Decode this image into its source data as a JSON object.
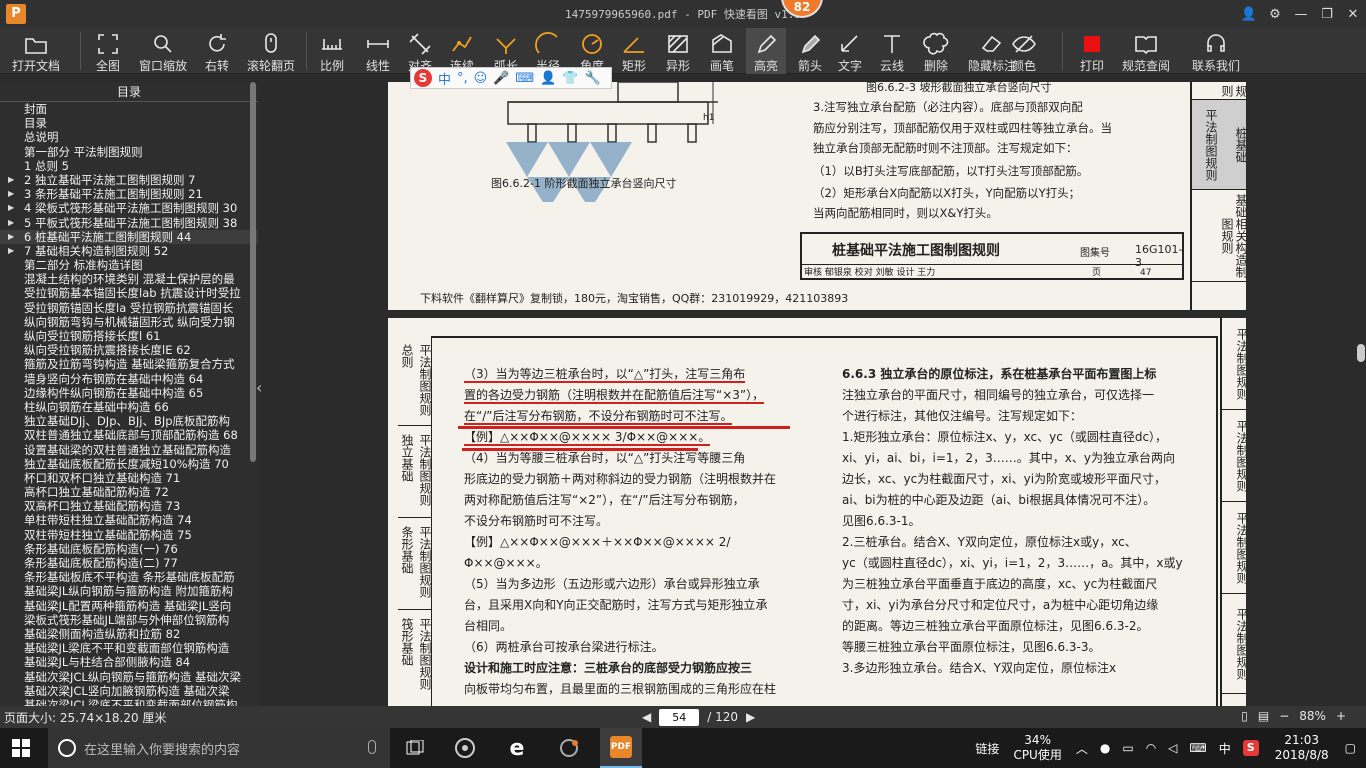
{
  "titlebar": {
    "title": "1475979965960.pdf - PDF 快速看图 v1.9",
    "logo": "P",
    "badge": "82"
  },
  "toolbar": {
    "items": [
      "打开文档",
      "全图",
      "窗口缩放",
      "右转",
      "滚轮翻页",
      "比例",
      "线性",
      "对齐",
      "连续",
      "弧长",
      "半径",
      "角度",
      "矩形",
      "异形",
      "画笔",
      "高亮",
      "箭头",
      "文字",
      "云线",
      "删除",
      "隐藏标注",
      "颜色",
      "打印",
      "规范查阅",
      "联系我们"
    ],
    "active": "高亮",
    "color_swatch": "#e81010"
  },
  "sidebar": {
    "header": "目录",
    "items": [
      {
        "label": "封面",
        "arrow": false
      },
      {
        "label": "目录",
        "arrow": false
      },
      {
        "label": "总说明",
        "arrow": false
      },
      {
        "label": "第一部分 平法制图规则",
        "arrow": false
      },
      {
        "label": "1 总则 5",
        "arrow": false
      },
      {
        "label": "2 独立基础平法施工图制图规则 7",
        "arrow": true
      },
      {
        "label": "3 条形基础平法施工图制图规则 21",
        "arrow": true
      },
      {
        "label": "4 梁板式筏形基础平法施工图制图规则 30",
        "arrow": true
      },
      {
        "label": "5 平板式筏形基础平法施工图制图规则 38",
        "arrow": true
      },
      {
        "label": "6 桩基础平法施工图制图规则 44",
        "arrow": true,
        "selected": true
      },
      {
        "label": "7 基础相关构造制图规则 52",
        "arrow": true
      },
      {
        "label": "第二部分 标准构造详图",
        "arrow": false
      },
      {
        "label": "混凝土结构的环境类别 混凝土保护层的最",
        "arrow": false
      },
      {
        "label": "受拉钢筋基本锚固长度lab 抗震设计时受拉",
        "arrow": false
      },
      {
        "label": "受拉钢筋锚固长度la 受拉钢筋抗震锚固长",
        "arrow": false
      },
      {
        "label": "纵向钢筋弯钩与机械锚固形式 纵向受力钢",
        "arrow": false
      },
      {
        "label": "纵向受拉钢筋搭接长度l 61",
        "arrow": false
      },
      {
        "label": "纵向受拉钢筋抗震搭接长度lE 62",
        "arrow": false
      },
      {
        "label": "箍筋及拉筋弯钩构造 基础梁箍筋复合方式",
        "arrow": false
      },
      {
        "label": "墙身竖向分布钢筋在基础中构造 64",
        "arrow": false
      },
      {
        "label": "边缘构件纵向钢筋在基础中构造 65",
        "arrow": false
      },
      {
        "label": "柱纵向钢筋在基础中构造 66",
        "arrow": false
      },
      {
        "label": "独立基础DJj、DJp、BJj、BJp底板配筋构",
        "arrow": false
      },
      {
        "label": "双柱普通独立基础底部与顶部配筋构造 68",
        "arrow": false
      },
      {
        "label": "设置基础梁的双柱普通独立基础配筋构造",
        "arrow": false
      },
      {
        "label": "独立基础底板配筋长度减短10%构造 70",
        "arrow": false
      },
      {
        "label": "杯口和双杯口独立基础构造 71",
        "arrow": false
      },
      {
        "label": "高杯口独立基础配筋构造 72",
        "arrow": false
      },
      {
        "label": "双高杯口独立基础配筋构造 73",
        "arrow": false
      },
      {
        "label": "单柱带短柱独立基础配筋构造 74",
        "arrow": false
      },
      {
        "label": "双柱带短柱独立基础配筋构造 75",
        "arrow": false
      },
      {
        "label": "条形基础底板配筋构造(一) 76",
        "arrow": false
      },
      {
        "label": "条形基础底板配筋构造(二) 77",
        "arrow": false
      },
      {
        "label": "条形基础板底不平构造 条形基础底板配筋",
        "arrow": false
      },
      {
        "label": "基础梁JL纵向钢筋与箍筋构造 附加箍筋构",
        "arrow": false
      },
      {
        "label": "基础梁JL配置两种箍筋构造 基础梁JL竖向",
        "arrow": false
      },
      {
        "label": "梁板式筏形基础JL端部与外伸部位钢筋构",
        "arrow": false
      },
      {
        "label": "基础梁侧面构造纵筋和拉筋 82",
        "arrow": false
      },
      {
        "label": "基础梁JL梁底不平和变截面部位钢筋构造",
        "arrow": false
      },
      {
        "label": "基础梁JL与柱结合部侧腋构造 84",
        "arrow": false
      },
      {
        "label": "基础次梁JCL纵向钢筋与箍筋构造 基础次梁",
        "arrow": false
      },
      {
        "label": "基础次梁JCL竖向加腋钢筋构造 基础次梁",
        "arrow": false
      },
      {
        "label": "基础次梁JCL梁底不平和变截面部位钢筋构",
        "arrow": false
      }
    ]
  },
  "page1": {
    "caption_top": "图6.6.2-3 坡形截面独立承台竖向尺寸",
    "caption_left": "图6.6.2-1 阶形截面独立承台竖向尺寸",
    "lines": [
      "3.注写独立承台配筋（必注内容）。底部与顶部双向配",
      "筋应分别注写，顶部配筋仅用于双柱或四柱等独立承台。当",
      "独立承台顶部无配筋时则不注顶部。注写规定如下：",
      "（1）以B打头注写底部配筋，以T打头注写顶部配筋。",
      "（2）矩形承台X向配筋以X打头，Y向配筋以Y打头；",
      "当两向配筋相同时，则以X&Y打头。"
    ],
    "title_block": {
      "title": "桩基础平法施工图制图规则",
      "atlas_label": "图集号",
      "atlas": "16G101-3",
      "row": "审核 郁银泉 校对 刘敏 设计 王力",
      "page_label": "页",
      "page": "47"
    },
    "side_tabs": [
      "规则",
      "平法制图规则",
      "桩基础",
      "基础相关构造制图规则"
    ],
    "footer": "下料软件《翻样算尺》复制锁，180元，淘宝销售，QQ群：231019929，421103893"
  },
  "page2": {
    "left_tabs": [
      "总则",
      "平法制图规则",
      "独立基础",
      "平法制图规则",
      "条形基础",
      "平法制图规则",
      "筏形基础",
      "平法制图规则"
    ],
    "right_tabs": [
      "平法制图规则",
      "平法制图规则",
      "平法制图规则",
      "平法制图规则"
    ],
    "left_col": [
      "（3）当为等边三桩承台时，以“△”打头，注写三角布",
      "置的各边受力钢筋（注明根数并在配筋值后注写“×3”），",
      "在“/”后注写分布钢筋，不设分布钢筋时可不注写。",
      "【例】△××Φ××@×××× 3/Φ××@×××。",
      "（4）当为等腰三桩承台时，以“△”打头注写等腰三角",
      "形底边的受力钢筋＋两对称斜边的受力钢筋（注明根数并在",
      "两对称配筋值后注写“×2”），在“/”后注写分布钢筋，",
      "不设分布钢筋时可不注写。",
      "【例】△××Φ××@×××＋××Φ××@×××× 2/Φ××@×××。",
      "（5）当为多边形（五边形或六边形）承台或异形独立承",
      "台，且采用X向和Y向正交配筋时，注写方式与矩形独立承",
      "台相同。",
      "（6）两桩承台可按承台梁进行标注。",
      "设计和施工时应注意：三桩承台的底部受力钢筋应按三",
      "向板带均匀布置，且最里面的三根钢筋围成的三角形应在柱"
    ],
    "right_col": [
      "6.6.3 独立承台的原位标注，系在桩基承台平面布置图上标",
      "注独立承台的平面尺寸，相同编号的独立承台，可仅选择一",
      "个进行标注，其他仅注编号。注写规定如下：",
      "1.矩形独立承台：原位标注x、y，xc、yc（或圆柱直径dc），",
      "xi、yi，ai、bi，i=1，2，3……。其中，x、y为独立承台两向",
      "边长，xc、yc为柱截面尺寸，xi、yi为阶宽或坡形平面尺寸，",
      "ai、bi为桩的中心距及边距（ai、bi根据具体情况可不注）。",
      "见图6.6.3-1。",
      "2.三桩承台。结合X、Y双向定位，原位标注x或y，xc、",
      "yc（或圆柱直径dc），xi、yi，i=1，2，3……，a。其中，x或y",
      "为三桩独立承台平面垂直于底边的高度，xc、yc为柱截面尺",
      "寸，xi、yi为承台分尺寸和定位尺寸，a为桩中心距切角边缘",
      "的距离。等边三桩独立承台平面原位标注，见图6.6.3-2。",
      "等腰三桩独立承台平面原位标注，见图6.6.3-3。",
      "3.多边形独立承台。结合X、Y双向定位，原位标注x"
    ]
  },
  "ime": {
    "logo": "S",
    "items": [
      "中",
      "°,",
      "☺",
      "🎤",
      "⌨",
      "👤",
      "👕",
      "🔧"
    ]
  },
  "statusbar": {
    "page_size": "页面大小: 25.74×18.20 厘米",
    "page_current": "54",
    "page_total": "/ 120",
    "zoom": "88%",
    "zoom_minus": "−",
    "zoom_plus": "+"
  },
  "taskbar": {
    "search_placeholder": "在这里输入你要搜索的内容",
    "network": "链接",
    "cpu_pct": "34%",
    "cpu_label": "CPU使用",
    "ime": "中",
    "time": "21:03",
    "date": "2018/8/8"
  }
}
